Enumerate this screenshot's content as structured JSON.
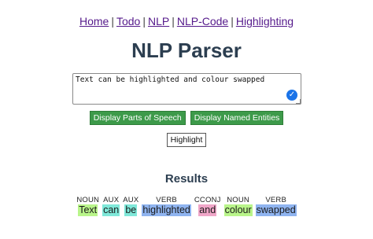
{
  "nav": {
    "links": [
      "Home",
      "Todo",
      "NLP",
      "NLP-Code",
      "Highlighting"
    ],
    "separator": "|"
  },
  "title": "NLP Parser",
  "input": {
    "value": "Text can be highlighted and colour swapped"
  },
  "buttons": {
    "pos": "Display Parts of Speech",
    "entities": "Display Named Entities",
    "highlight": "Highlight"
  },
  "results": {
    "title": "Results",
    "tokens": [
      {
        "tag": "NOUN",
        "word": "Text",
        "color": "#b9f58a"
      },
      {
        "tag": "AUX",
        "word": "can",
        "color": "#7fe8d9"
      },
      {
        "tag": "AUX",
        "word": "be",
        "color": "#7fe8d9"
      },
      {
        "tag": "VERB",
        "word": "highlighted",
        "color": "#8fb4f0"
      },
      {
        "tag": "CCONJ",
        "word": "and",
        "color": "#f0a6c8"
      },
      {
        "tag": "NOUN",
        "word": "colour",
        "color": "#b9f58a"
      },
      {
        "tag": "VERB",
        "word": "swapped",
        "color": "#8fb4f0"
      }
    ]
  },
  "colors": {
    "title": "#2c3e50",
    "link": "#551a8b",
    "button_green": "#3d9a4a"
  }
}
